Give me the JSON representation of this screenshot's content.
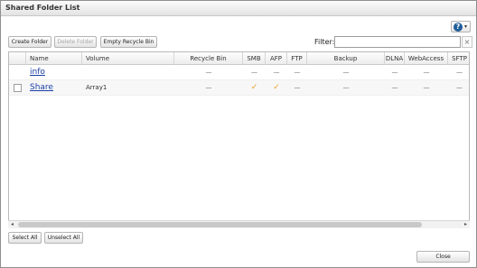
{
  "window": {
    "title": "Shared Folder List"
  },
  "toolbar": {
    "create_folder": "Create Folder",
    "delete_folder": "Delete Folder",
    "empty_recycle_bin": "Empty Recycle Bin",
    "filter_label": "Filter:",
    "filter_value": "",
    "filter_clear": "×",
    "help_symbol": "?",
    "help_caret": "▾"
  },
  "table": {
    "columns": [
      "Name",
      "Volume",
      "Recycle Bin",
      "SMB",
      "AFP",
      "FTP",
      "Backup",
      "DLNA",
      "WebAccess",
      "SFTP"
    ],
    "rows": [
      {
        "name": "info",
        "volume": "",
        "recycle_bin": "—",
        "smb": "—",
        "afp": "—",
        "ftp": "—",
        "backup": "—",
        "dlna": "—",
        "webaccess": "—",
        "sftp": "—"
      },
      {
        "name": "Share",
        "volume": "Array1",
        "recycle_bin": "—",
        "smb": "✓",
        "afp": "✓",
        "ftp": "—",
        "backup": "—",
        "dlna": "—",
        "webaccess": "—",
        "sftp": "—"
      }
    ]
  },
  "scrollbar": {
    "left_arrow": "◂",
    "right_arrow": "▸"
  },
  "footer": {
    "select_all": "Select All",
    "unselect_all": "Unselect All",
    "close": "Close"
  },
  "colors": {
    "link": "#1b3fa6",
    "check": "#e8a12c",
    "help_icon": "#1f5d99"
  }
}
